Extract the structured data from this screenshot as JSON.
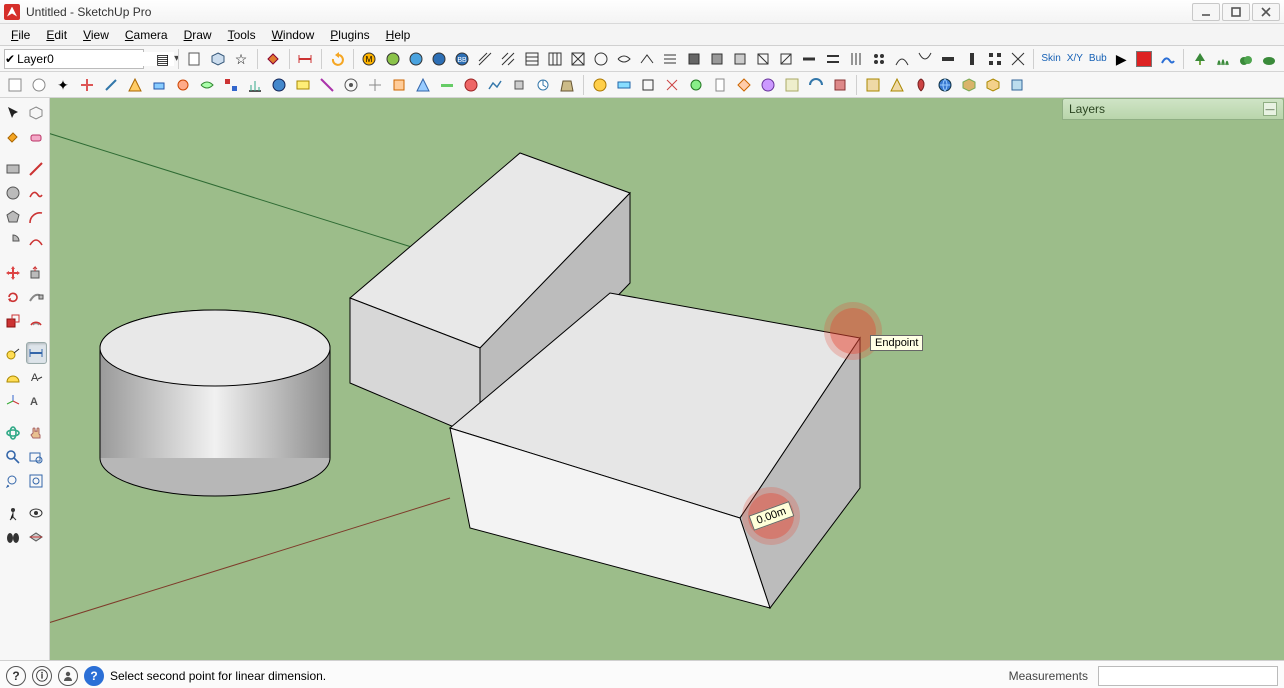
{
  "window": {
    "title": "Untitled - SketchUp Pro"
  },
  "menu": [
    "File",
    "Edit",
    "View",
    "Camera",
    "Draw",
    "Tools",
    "Window",
    "Plugins",
    "Help"
  ],
  "layer": {
    "current": "Layer0",
    "panel_title": "Layers"
  },
  "text_buttons": {
    "skin": "Skin",
    "xy": "X/Y",
    "bub": "Bub"
  },
  "viewport": {
    "tooltip": "Endpoint",
    "dimension_value": "0.00m"
  },
  "status": {
    "hint": "Select second point for linear dimension.",
    "measurements_label": "Measurements",
    "measurements_value": ""
  }
}
